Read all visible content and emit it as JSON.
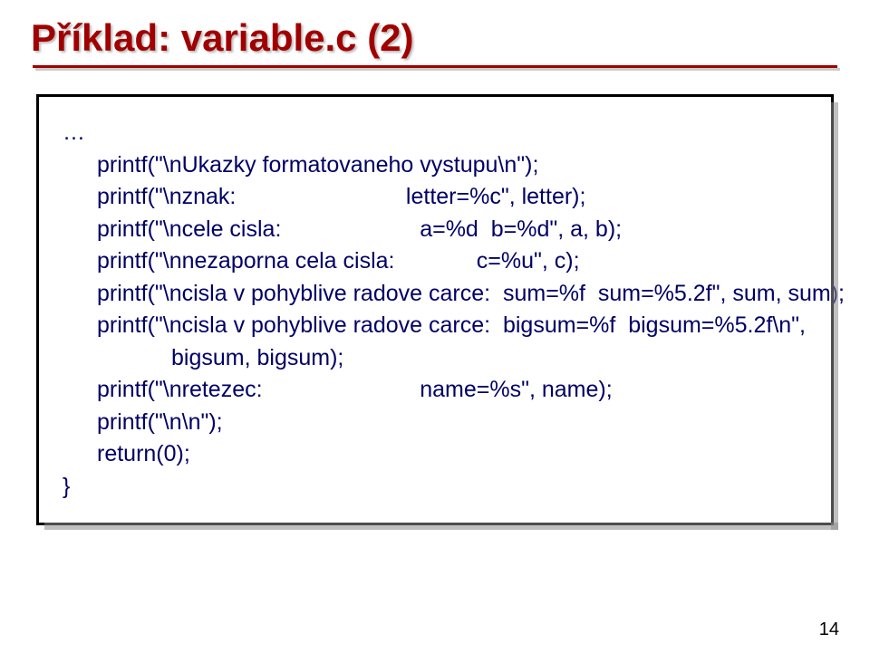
{
  "title": "Příklad:  variable.c  (2)",
  "code": {
    "l0": "…",
    "l1": "printf(\"\\nUkazky formatovaneho vystupu\\n\");",
    "l2": "printf(\"\\nznak:                           letter=%c\", letter);",
    "l3": "printf(\"\\ncele cisla:                      a=%d  b=%d\", a, b);",
    "l4": "printf(\"\\nnezaporna cela cisla:             c=%u\", c);",
    "l5": "printf(\"\\ncisla v pohyblive radove carce:  sum=%f  sum=%5.2f\", sum, sum);",
    "l6": "printf(\"\\ncisla v pohyblive radove carce:  bigsum=%f  bigsum=%5.2f\\n\",",
    "l7": "bigsum, bigsum);",
    "l8": "printf(\"\\nretezec:                         name=%s\", name);",
    "l9": "printf(\"\\n\\n\");",
    "l10": "return(0);",
    "l11": "}"
  },
  "page_number": "14"
}
